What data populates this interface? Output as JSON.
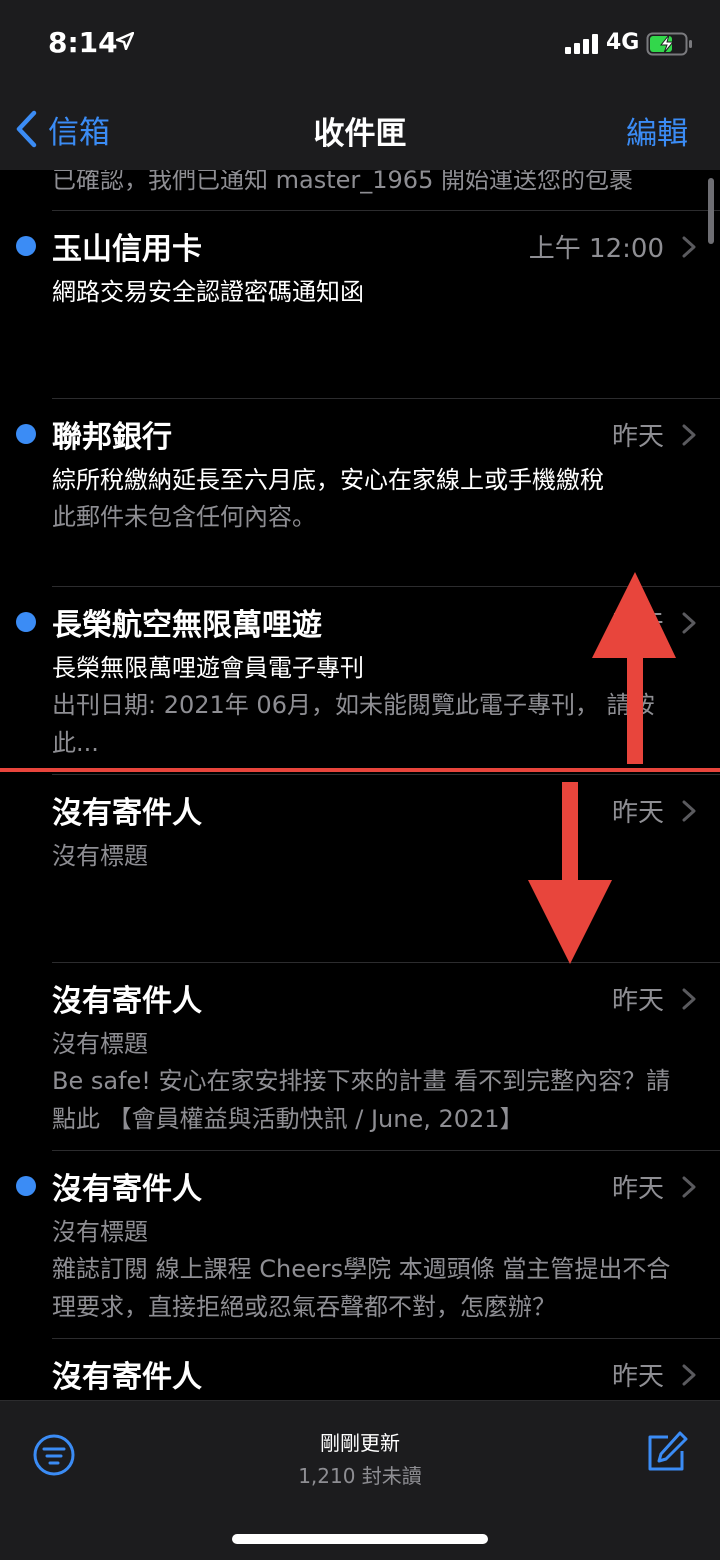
{
  "status": {
    "time": "8:14",
    "network": "4G",
    "location_icon": "location-arrow-icon",
    "signal_icon": "cellular-signal-icon",
    "battery_icon": "battery-charging-icon"
  },
  "nav": {
    "back_label": "信箱",
    "title": "收件匣",
    "edit_label": "編輯"
  },
  "list": {
    "cut_preview": "已確認，我們已通知 master_1965 開始運送您的包裹",
    "items": [
      {
        "sender": "玉山信用卡",
        "date": "上午 12:00",
        "subject": "網路交易安全認證密碼通知函",
        "preview": "",
        "unread": true
      },
      {
        "sender": "聯邦銀行",
        "date": "昨天",
        "subject": "綜所稅繳納延長至六月底，安心在家線上或手機繳稅",
        "preview": "此郵件未包含任何內容。",
        "unread": true
      },
      {
        "sender": "長榮航空無限萬哩遊",
        "date": "昨天",
        "subject": "長榮無限萬哩遊會員電子專刊",
        "preview": "出刊日期: 2021年 06月，如未能閱覽此電子專刊， 請按此...",
        "unread": true
      },
      {
        "sender": "沒有寄件人",
        "date": "昨天",
        "subject": "沒有標題",
        "preview": "",
        "unread": false
      },
      {
        "sender": "沒有寄件人",
        "date": "昨天",
        "subject": "沒有標題",
        "preview": "Be safe! 安心在家安排接下來的計畫 看不到完整內容？請點此 【會員權益與活動快訊 / June, 2021】",
        "unread": false
      },
      {
        "sender": "沒有寄件人",
        "date": "昨天",
        "subject": "沒有標題",
        "preview": "雜誌訂閱 線上課程 Cheers學院 本週頭條 當主管提出不合理要求，直接拒絕或忍氣吞聲都不對，怎麼辦？",
        "unread": true
      },
      {
        "sender": "沒有寄件人",
        "date": "昨天",
        "subject": "",
        "preview": "",
        "unread": false
      }
    ]
  },
  "toolbar": {
    "updated": "剛剛更新",
    "unread_count": "1,210 封未讀",
    "filter_icon": "filter-icon",
    "compose_icon": "compose-icon"
  },
  "colors": {
    "accent": "#3b8cf5",
    "annotation": "#e8453c",
    "bar_background": "#1c1c1e",
    "secondary_text": "#8e8e93"
  }
}
